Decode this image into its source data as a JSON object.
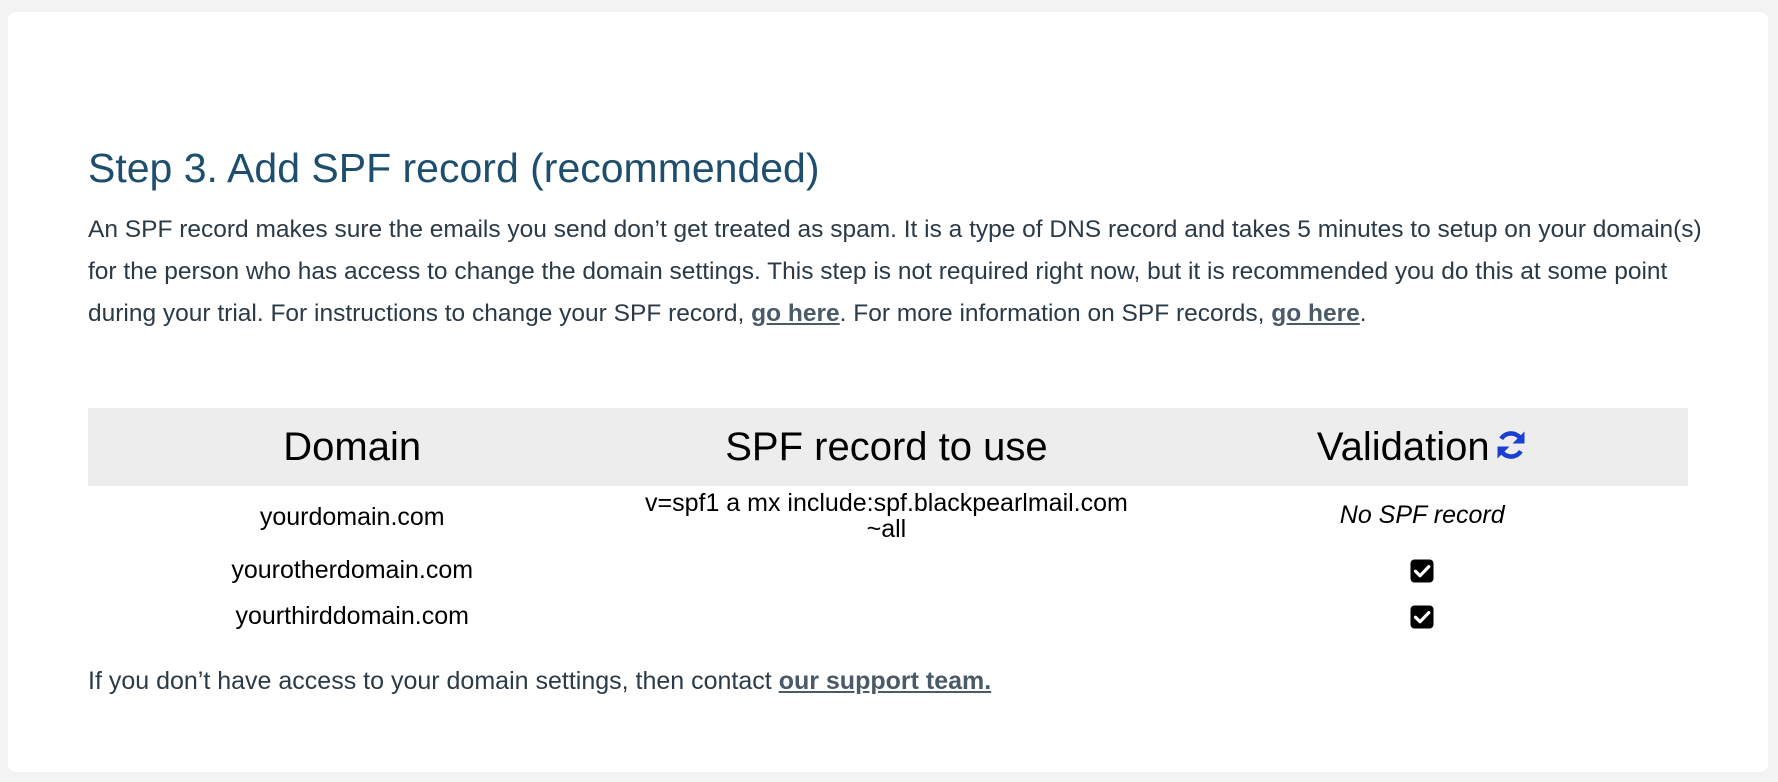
{
  "section": {
    "title": "Step 3. Add SPF record (recommended)",
    "intro_before_link1": "An SPF record makes sure the emails you send don’t get treated as spam. It is a type of DNS record and takes 5 minutes to setup on your domain(s) for the person who has access to change the domain settings. This step is not required right now, but it is recommended you do this at some point during your trial. For instructions to change your SPF record, ",
    "link1_label": "go here",
    "intro_between_links": ". For more information on SPF records, ",
    "link2_label": "go here",
    "intro_after_link2": "."
  },
  "table": {
    "headers": {
      "domain": "Domain",
      "spf": "SPF record to use",
      "validation": "Validation"
    },
    "rows": [
      {
        "domain": "yourdomain.com",
        "spf_line1": "v=spf1 a mx include:spf.blackpearlmail.com",
        "spf_line2": "~all",
        "status": "No SPF record"
      },
      {
        "domain": "yourotherdomain.com",
        "status_icon": "checkbox-checked-icon"
      },
      {
        "domain": "yourthirddomain.com",
        "status_icon": "checkbox-checked-icon"
      }
    ]
  },
  "footer": {
    "text_before_link": "If you don’t have access to your domain settings, then contact ",
    "link_label": "our support team."
  },
  "icons": {
    "refresh": "refresh-icon",
    "check": "checkbox-checked-icon"
  },
  "colors": {
    "heading": "#1d4e6e",
    "body_text": "#2b3a47",
    "link": "#4a5a68",
    "refresh_icon": "#1a3fd1",
    "table_header_bg": "#ededed"
  }
}
